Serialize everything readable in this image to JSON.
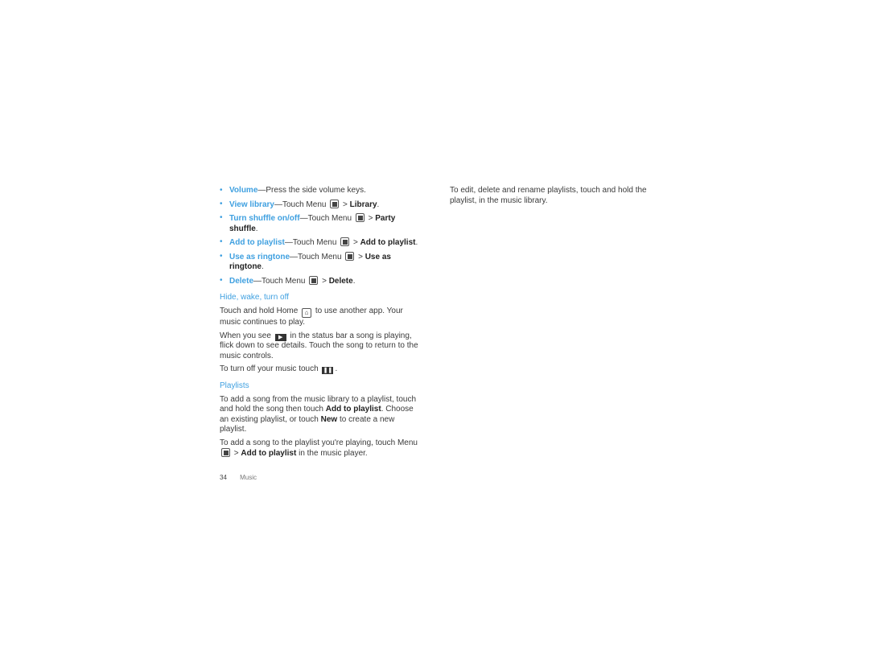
{
  "bullets": [
    {
      "term": "Volume",
      "rest": "—Press the side volume keys.",
      "icon": null,
      "target": "",
      "end": ""
    },
    {
      "term": "View library",
      "rest": "—Touch Menu",
      "icon": "menu-icon",
      "target": "Library",
      "end": "."
    },
    {
      "term": "Turn shuffle on/off",
      "rest": "—Touch Menu",
      "icon": "menu-icon",
      "target": "Party shuffle",
      "end": "."
    },
    {
      "term": "Add to playlist",
      "rest": "—Touch Menu",
      "icon": "menu-icon",
      "target": "Add to playlist",
      "end": "."
    },
    {
      "term": "Use as ringtone",
      "rest": "—Touch Menu",
      "icon": "menu-icon",
      "target": "Use as ringtone",
      "end": "."
    },
    {
      "term": "Delete",
      "rest": "—Touch Menu",
      "icon": "menu-icon",
      "target": "Delete",
      "end": "."
    }
  ],
  "section_hide": {
    "heading": "Hide, wake, turn off",
    "p1_a": "Touch and hold Home",
    "p1_b": "to use another app. Your music continues to play.",
    "p2_a": "When you see",
    "p2_b": "in the status bar a song is playing, flick down to see details. Touch the song to return to the music controls.",
    "p3_a": "To turn off your music touch",
    "p3_b": "."
  },
  "section_playlists": {
    "heading": "Playlists",
    "p1_a": "To add a song from the music library to a playlist, touch and hold the song then touch",
    "p1_bold1": "Add to playlist",
    "p1_b": ". Choose an existing playlist, or touch",
    "p1_bold2": "New",
    "p1_c": "to create a new playlist.",
    "p2_a": "To add a song to the playlist you're playing, touch Menu",
    "p2_sep": ">",
    "p2_bold": "Add to playlist",
    "p2_b": "in the music player."
  },
  "right_column": {
    "p1": "To edit, delete and rename playlists, touch and hold the playlist, in the music library."
  },
  "footer": {
    "page_number": "34",
    "section": "Music"
  },
  "separator": ">"
}
